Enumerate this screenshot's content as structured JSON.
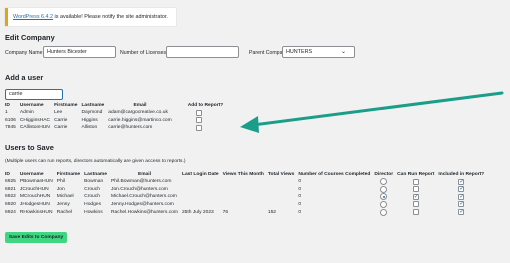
{
  "notice": {
    "link": "WordPress 6.4.2",
    "text": " is available! Please notify the site administrator."
  },
  "edit_company": {
    "title": "Edit Company",
    "company_name_label": "Company Name:",
    "company_name_value": "Hunters Bicester",
    "licenses_label": "Number of Licenses:",
    "licenses_value": "",
    "parent_label": "Parent Company:",
    "parent_value": "HUNTERS"
  },
  "add_user": {
    "title": "Add a user",
    "search_value": "carrie",
    "headers": [
      "ID",
      "Username",
      "Firstname",
      "Lastname",
      "Email",
      "Add to Report?"
    ],
    "rows": [
      {
        "id": "1",
        "username": "Admin",
        "first": "Lee",
        "last": "Daymond",
        "email": "adam@cargocreative.co.uk"
      },
      {
        "id": "6106",
        "username": "CHigginsHAC",
        "first": "Carrie",
        "last": "Higgins",
        "email": "carrie.higgins@martinco.com"
      },
      {
        "id": "7845",
        "username": "CAllistonHUN",
        "first": "Carrie",
        "last": "Alliston",
        "email": "carrie@hunters.com"
      }
    ]
  },
  "users_save": {
    "title": "Users to Save",
    "note": "(Multiple users can run reports, directors automatically are given access to reports.)",
    "headers": [
      "ID",
      "Username",
      "Firstname",
      "Lastname",
      "Email",
      "Last Login Date",
      "Views This Month",
      "Total Views",
      "Number of Courses Completed",
      "Director",
      "Can Run Report",
      "Included in Report?"
    ],
    "rows": [
      {
        "id": "6925",
        "username": "PBowmanHUN",
        "first": "Phil",
        "last": "Bowman",
        "email": "Phil.Bowman@hunters.com",
        "last_login": "",
        "views_month": "",
        "total_views": "",
        "courses": "0",
        "director": false,
        "can_run": false,
        "included": true
      },
      {
        "id": "6921",
        "username": "JCrouchHUN",
        "first": "Jon",
        "last": "Crouch",
        "email": "Jon.Crouch@hunters.com",
        "last_login": "",
        "views_month": "",
        "total_views": "",
        "courses": "0",
        "director": false,
        "can_run": false,
        "included": true
      },
      {
        "id": "6922",
        "username": "MCrouchHUN",
        "first": "Michael",
        "last": "Crouch",
        "email": "Michael.Crouch@hunters.com",
        "last_login": "",
        "views_month": "",
        "total_views": "",
        "courses": "0",
        "director": true,
        "can_run": true,
        "included": true
      },
      {
        "id": "6920",
        "username": "JHodgesHUN",
        "first": "Jenny",
        "last": "Hodges",
        "email": "Jenny.Hodges@hunters.com",
        "last_login": "",
        "views_month": "",
        "total_views": "",
        "courses": "0",
        "director": false,
        "can_run": false,
        "included": true
      },
      {
        "id": "6924",
        "username": "RHowkinsHUN",
        "first": "Rachel",
        "last": "Howkins",
        "email": "Rachel.Howkins@hunters.com",
        "last_login": "25th July 2023",
        "views_month": "76",
        "total_views": "152",
        "courses": "0",
        "director": false,
        "can_run": false,
        "included": true
      }
    ]
  },
  "save_button": "Save Edits to Company",
  "colors": {
    "arrow": "#1a9e8a",
    "button": "#3fd583",
    "link": "#2271b1"
  }
}
